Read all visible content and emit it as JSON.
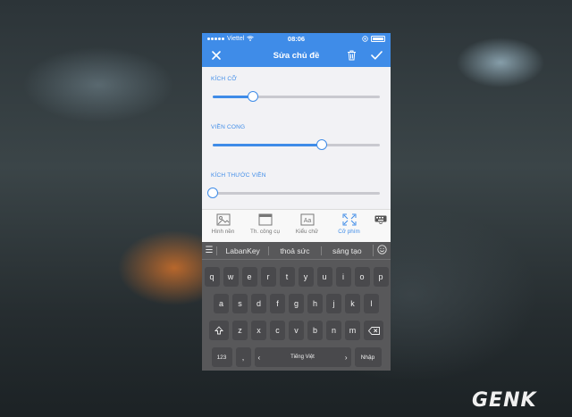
{
  "status": {
    "carrier": "Viettel",
    "time": "08:06"
  },
  "nav": {
    "title": "Sửa chủ đề",
    "icons": [
      "close-icon",
      "trash-icon",
      "check-icon"
    ]
  },
  "settings": [
    {
      "label": "KÍCH CỠ",
      "value": 0.24
    },
    {
      "label": "VIỀN CONG",
      "value": 0.65
    },
    {
      "label": "KÍCH THƯỚC VIỀN",
      "value": 0.0
    }
  ],
  "tabs": [
    {
      "label": "Hình nền",
      "icon": "image-icon",
      "active": false
    },
    {
      "label": "Th. công cụ",
      "icon": "toolbar-icon",
      "active": false
    },
    {
      "label": "Kiểu chữ",
      "icon": "font-icon",
      "active": false
    },
    {
      "label": "Cỡ phím",
      "icon": "resize-icon",
      "active": true
    }
  ],
  "keyboard": {
    "suggestions": [
      "LabanKey",
      "thoả sức",
      "sáng tạo"
    ],
    "row1": [
      "q",
      "w",
      "e",
      "r",
      "t",
      "y",
      "u",
      "i",
      "o",
      "p"
    ],
    "row2": [
      "a",
      "s",
      "d",
      "f",
      "g",
      "h",
      "j",
      "k",
      "l"
    ],
    "row3": [
      "z",
      "x",
      "c",
      "v",
      "b",
      "n",
      "m"
    ],
    "num_label": "123",
    "comma_label": ",",
    "space_label": "Tiếng Việt",
    "enter_label": "Nhập"
  },
  "watermark": "GENK",
  "colors": {
    "accent": "#3f8ce8"
  }
}
